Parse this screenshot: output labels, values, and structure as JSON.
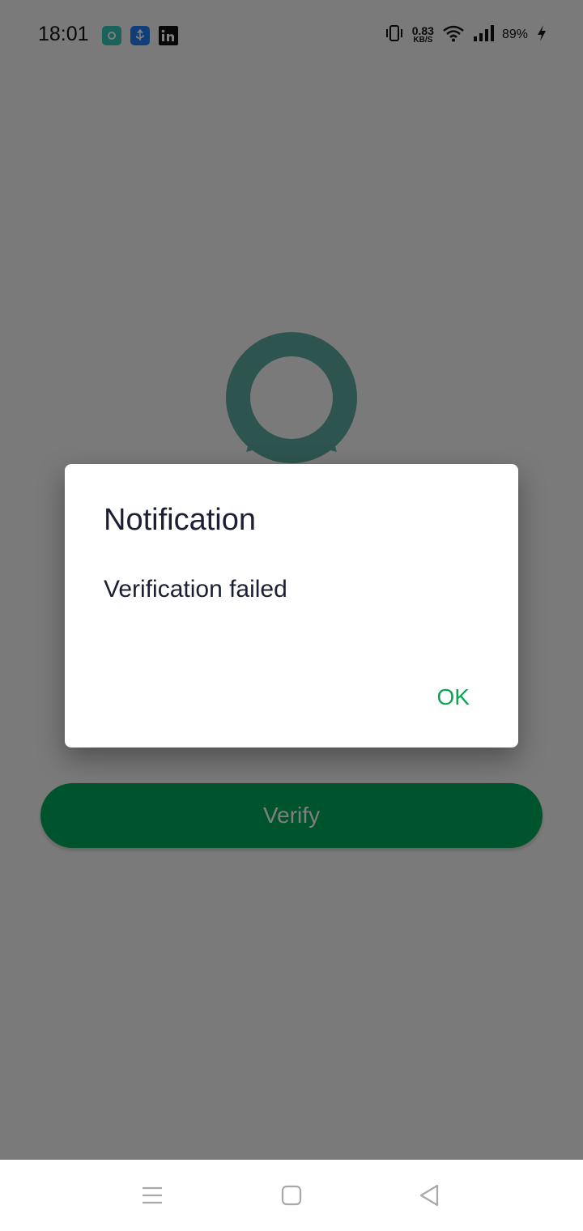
{
  "status_bar": {
    "time": "18:01",
    "net_speed_value": "0.83",
    "net_speed_unit": "KB/S",
    "battery": "89%",
    "notification_icons": [
      "app-notification-icon",
      "usb-icon",
      "linkedin-icon"
    ]
  },
  "main": {
    "verify_label": "Verify",
    "logo_color": "#5aa89c",
    "button_color": "#00a85a"
  },
  "dialog": {
    "title": "Notification",
    "message": "Verification failed",
    "ok_label": "OK",
    "ok_color": "#0aa654"
  },
  "nav_bar": {
    "buttons": [
      "menu-icon",
      "home-icon",
      "back-icon"
    ]
  }
}
